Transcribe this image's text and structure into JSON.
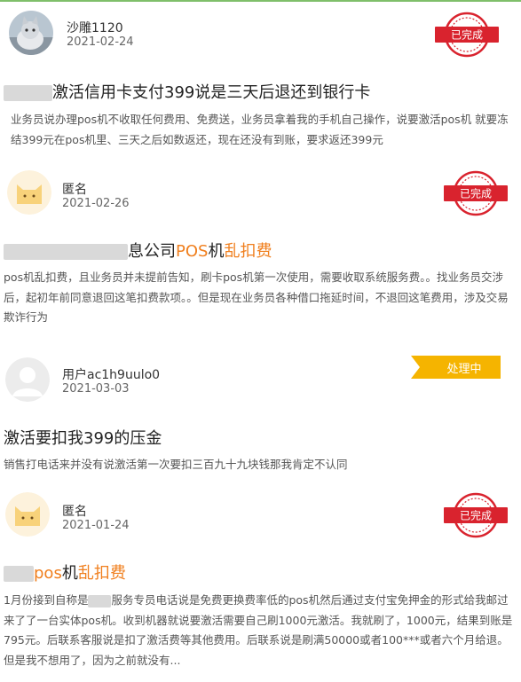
{
  "complaints": [
    {
      "user": "沙雕1120",
      "date": "2021-02-24",
      "avatar": "cat-photo-avatar",
      "status": "已完成",
      "title_prefix": "",
      "title_rest": "激活信用卡支付399说是三天后退还到银行卡",
      "title_highlight": "",
      "desc": "业务员说办理pos机不收取任何费用、免费送，业务员拿着我的手机自己操作，说要激活pos机 就要冻结399元在pos机里、三天之后如数返还，现在还没有到账，要求返还399元"
    },
    {
      "user": "匿名",
      "date": "2021-02-26",
      "avatar": "cat-icon-avatar",
      "status": "已完成",
      "title_prefix": "息公司",
      "title_highlight": "POS",
      "title_middle": "机",
      "title_highlight2": "乱扣费",
      "desc": "pos机乱扣费，且业务员并未提前告知，刷卡pos机第一次使用，需要收取系统服务费。。找业务员交涉后，起初年前同意退回这笔扣费款项。。但是现在业务员各种借口拖延时间，不退回这笔费用，涉及交易欺诈行为"
    },
    {
      "user": "用户ac1h9uulo0",
      "date": "2021-03-03",
      "avatar": "default-user-avatar",
      "status": "处理中",
      "title": "激活要扣我399的压金",
      "desc": "销售打电话来并没有说激活第一次要扣三百九十九块钱那我肯定不认同"
    },
    {
      "user": "匿名",
      "date": "2021-01-24",
      "avatar": "cat-icon-avatar",
      "status": "已完成",
      "title_prefix": "",
      "title_highlight": "pos",
      "title_middle": "机",
      "title_highlight2": "乱扣费",
      "desc_a": "1月份接到自称是",
      "desc_b": "服务专员电话说是免费更换费率低的pos机然后通过支付宝免押金的形式给我邮过来了了一台实体pos机。收到机器就说要激活需要自己刷1000元激活。我就刷了，1000元，结果到账是795元。后联系客服说是扣了激活费等其他费用。后联系说是刷满50000或者100***或者六个月给退。但是我不想用了，因为之前就没有..."
    }
  ],
  "colors": {
    "highlight": "#f07f1e",
    "stamp": "#d9232e",
    "processing": "#f5b400"
  }
}
